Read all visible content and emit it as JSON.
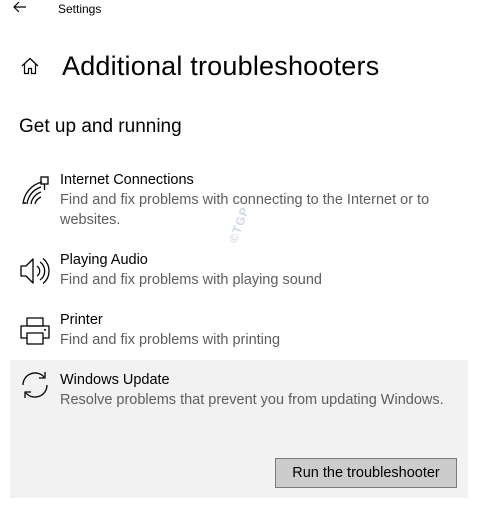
{
  "window": {
    "title": "Settings"
  },
  "header": {
    "title": "Additional troubleshooters",
    "home_icon": "home-icon",
    "back_icon": "arrow-left-icon"
  },
  "section": {
    "title": "Get up and running"
  },
  "items": [
    {
      "icon": "wifi-network-icon",
      "name": "Internet Connections",
      "description": "Find and fix problems with connecting to the Internet or to websites."
    },
    {
      "icon": "speaker-icon",
      "name": "Playing Audio",
      "description": "Find and fix problems with playing sound"
    },
    {
      "icon": "printer-icon",
      "name": "Printer",
      "description": "Find and fix problems with printing"
    },
    {
      "icon": "sync-icon",
      "name": "Windows Update",
      "description": "Resolve problems that prevent you from updating Windows.",
      "selected": true,
      "action_label": "Run the troubleshooter"
    }
  ],
  "watermark": "©TGP",
  "colors": {
    "selected_bg": "#f2f2f2",
    "button_bg": "#cccccc",
    "button_border": "#7a7a7a",
    "description_text": "#5d5d5d"
  }
}
